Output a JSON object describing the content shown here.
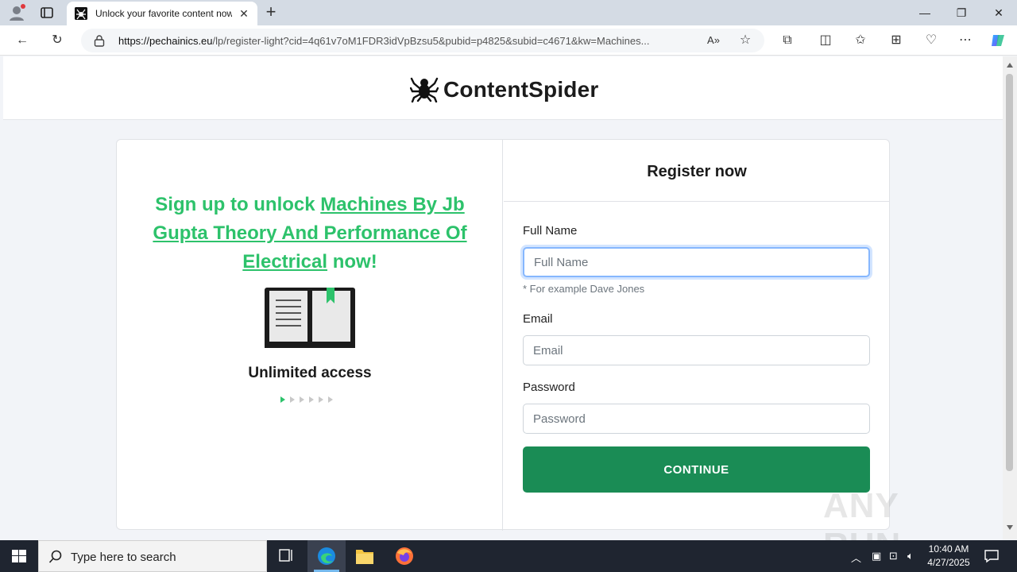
{
  "browser": {
    "tab_title": "Unlock your favorite content now",
    "address_url_host": "https://pechainics.eu",
    "address_url_path": "/lp/register-light?cid=4q61v7oM1FDR3idVpBzsu5&pubid=p4825&subid=c4671&kw=Machines...",
    "icons": [
      "profile-icon",
      "tab-actions-icon",
      "close-icon",
      "new-tab-icon",
      "minimize-icon",
      "restore-icon",
      "window-close-icon",
      "back-icon",
      "refresh-icon",
      "lock-icon",
      "read-aloud-icon",
      "favorite-star-icon",
      "extensions-icon",
      "split-screen-icon",
      "favorites-icon",
      "collections-icon",
      "browser-essentials-icon",
      "more-icon",
      "copilot-icon"
    ]
  },
  "site": {
    "brand_name": "ContentSpider"
  },
  "left_panel": {
    "headline_prefix": "Sign up to unlock ",
    "headline_link": "Machines By Jb Gupta Theory And Performance Of Electrical",
    "headline_suffix": " now!",
    "feature_label": "Unlimited access",
    "carousel_count": 6,
    "carousel_active": 1
  },
  "form": {
    "title": "Register now",
    "full_name_label": "Full Name",
    "full_name_placeholder": "Full Name",
    "full_name_value": "",
    "full_name_hint": "* For example Dave Jones",
    "email_label": "Email",
    "email_placeholder": "Email",
    "email_value": "",
    "password_label": "Password",
    "password_placeholder": "Password",
    "password_value": "",
    "continue_label": "CONTINUE"
  },
  "watermark_text": "ANY RUN",
  "taskbar": {
    "search_placeholder": "Type here to search",
    "time": "10:40 AM",
    "date": "4/27/2025"
  },
  "colors": {
    "accent_green": "#2dc26b",
    "button_green": "#1a8c55",
    "focus_blue": "#86b7fe"
  }
}
